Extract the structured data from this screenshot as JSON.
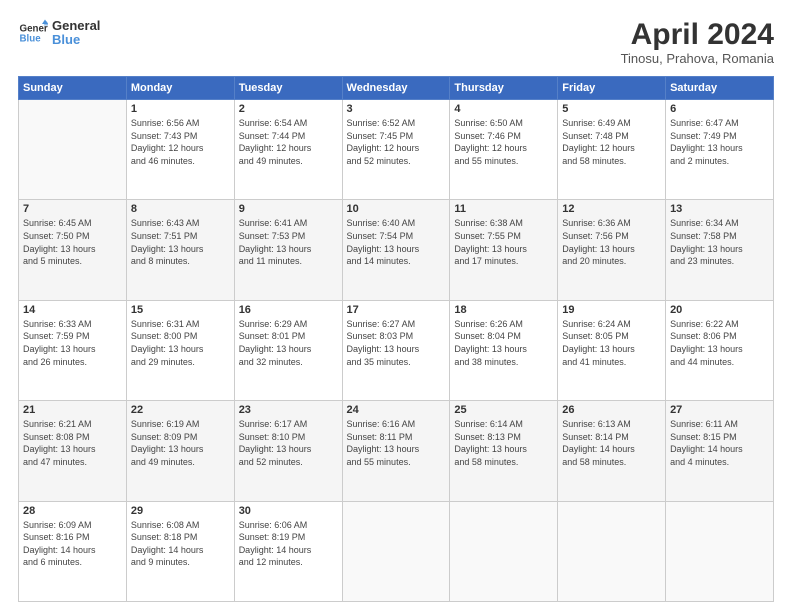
{
  "header": {
    "logo_line1": "General",
    "logo_line2": "Blue",
    "month": "April 2024",
    "location": "Tinosu, Prahova, Romania"
  },
  "weekdays": [
    "Sunday",
    "Monday",
    "Tuesday",
    "Wednesday",
    "Thursday",
    "Friday",
    "Saturday"
  ],
  "weeks": [
    [
      {
        "day": "",
        "info": ""
      },
      {
        "day": "1",
        "info": "Sunrise: 6:56 AM\nSunset: 7:43 PM\nDaylight: 12 hours\nand 46 minutes."
      },
      {
        "day": "2",
        "info": "Sunrise: 6:54 AM\nSunset: 7:44 PM\nDaylight: 12 hours\nand 49 minutes."
      },
      {
        "day": "3",
        "info": "Sunrise: 6:52 AM\nSunset: 7:45 PM\nDaylight: 12 hours\nand 52 minutes."
      },
      {
        "day": "4",
        "info": "Sunrise: 6:50 AM\nSunset: 7:46 PM\nDaylight: 12 hours\nand 55 minutes."
      },
      {
        "day": "5",
        "info": "Sunrise: 6:49 AM\nSunset: 7:48 PM\nDaylight: 12 hours\nand 58 minutes."
      },
      {
        "day": "6",
        "info": "Sunrise: 6:47 AM\nSunset: 7:49 PM\nDaylight: 13 hours\nand 2 minutes."
      }
    ],
    [
      {
        "day": "7",
        "info": "Sunrise: 6:45 AM\nSunset: 7:50 PM\nDaylight: 13 hours\nand 5 minutes."
      },
      {
        "day": "8",
        "info": "Sunrise: 6:43 AM\nSunset: 7:51 PM\nDaylight: 13 hours\nand 8 minutes."
      },
      {
        "day": "9",
        "info": "Sunrise: 6:41 AM\nSunset: 7:53 PM\nDaylight: 13 hours\nand 11 minutes."
      },
      {
        "day": "10",
        "info": "Sunrise: 6:40 AM\nSunset: 7:54 PM\nDaylight: 13 hours\nand 14 minutes."
      },
      {
        "day": "11",
        "info": "Sunrise: 6:38 AM\nSunset: 7:55 PM\nDaylight: 13 hours\nand 17 minutes."
      },
      {
        "day": "12",
        "info": "Sunrise: 6:36 AM\nSunset: 7:56 PM\nDaylight: 13 hours\nand 20 minutes."
      },
      {
        "day": "13",
        "info": "Sunrise: 6:34 AM\nSunset: 7:58 PM\nDaylight: 13 hours\nand 23 minutes."
      }
    ],
    [
      {
        "day": "14",
        "info": "Sunrise: 6:33 AM\nSunset: 7:59 PM\nDaylight: 13 hours\nand 26 minutes."
      },
      {
        "day": "15",
        "info": "Sunrise: 6:31 AM\nSunset: 8:00 PM\nDaylight: 13 hours\nand 29 minutes."
      },
      {
        "day": "16",
        "info": "Sunrise: 6:29 AM\nSunset: 8:01 PM\nDaylight: 13 hours\nand 32 minutes."
      },
      {
        "day": "17",
        "info": "Sunrise: 6:27 AM\nSunset: 8:03 PM\nDaylight: 13 hours\nand 35 minutes."
      },
      {
        "day": "18",
        "info": "Sunrise: 6:26 AM\nSunset: 8:04 PM\nDaylight: 13 hours\nand 38 minutes."
      },
      {
        "day": "19",
        "info": "Sunrise: 6:24 AM\nSunset: 8:05 PM\nDaylight: 13 hours\nand 41 minutes."
      },
      {
        "day": "20",
        "info": "Sunrise: 6:22 AM\nSunset: 8:06 PM\nDaylight: 13 hours\nand 44 minutes."
      }
    ],
    [
      {
        "day": "21",
        "info": "Sunrise: 6:21 AM\nSunset: 8:08 PM\nDaylight: 13 hours\nand 47 minutes."
      },
      {
        "day": "22",
        "info": "Sunrise: 6:19 AM\nSunset: 8:09 PM\nDaylight: 13 hours\nand 49 minutes."
      },
      {
        "day": "23",
        "info": "Sunrise: 6:17 AM\nSunset: 8:10 PM\nDaylight: 13 hours\nand 52 minutes."
      },
      {
        "day": "24",
        "info": "Sunrise: 6:16 AM\nSunset: 8:11 PM\nDaylight: 13 hours\nand 55 minutes."
      },
      {
        "day": "25",
        "info": "Sunrise: 6:14 AM\nSunset: 8:13 PM\nDaylight: 13 hours\nand 58 minutes."
      },
      {
        "day": "26",
        "info": "Sunrise: 6:13 AM\nSunset: 8:14 PM\nDaylight: 14 hours\nand 58 minutes."
      },
      {
        "day": "27",
        "info": "Sunrise: 6:11 AM\nSunset: 8:15 PM\nDaylight: 14 hours\nand 4 minutes."
      }
    ],
    [
      {
        "day": "28",
        "info": "Sunrise: 6:09 AM\nSunset: 8:16 PM\nDaylight: 14 hours\nand 6 minutes."
      },
      {
        "day": "29",
        "info": "Sunrise: 6:08 AM\nSunset: 8:18 PM\nDaylight: 14 hours\nand 9 minutes."
      },
      {
        "day": "30",
        "info": "Sunrise: 6:06 AM\nSunset: 8:19 PM\nDaylight: 14 hours\nand 12 minutes."
      },
      {
        "day": "",
        "info": ""
      },
      {
        "day": "",
        "info": ""
      },
      {
        "day": "",
        "info": ""
      },
      {
        "day": "",
        "info": ""
      }
    ]
  ]
}
